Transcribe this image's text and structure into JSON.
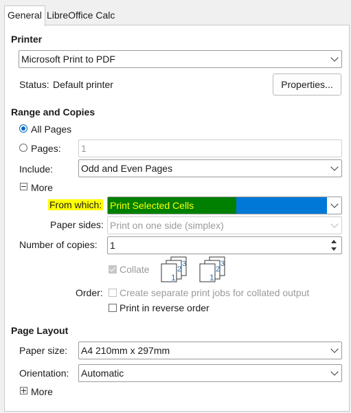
{
  "tabs": [
    {
      "label": "General",
      "active": true
    },
    {
      "label": "LibreOffice Calc",
      "active": false
    }
  ],
  "printer": {
    "heading": "Printer",
    "selected": "Microsoft Print to PDF",
    "status_label": "Status:",
    "status_value": "Default printer",
    "properties_button": "Properties..."
  },
  "range": {
    "heading": "Range and Copies",
    "all_pages": "All Pages",
    "pages_label": "Pages:",
    "pages_value": "1",
    "include_label": "Include:",
    "include_value": "Odd and Even Pages",
    "more_label": "More",
    "from_which_label": "From which:",
    "from_which_value": "Print Selected Cells",
    "paper_sides_label": "Paper sides:",
    "paper_sides_value": "Print on one side (simplex)",
    "copies_label": "Number of copies:",
    "copies_value": "1",
    "collate_label": "Collate",
    "order_label": "Order:",
    "separate_jobs_label": "Create separate print jobs for collated output",
    "reverse_order_label": "Print in reverse order"
  },
  "layout": {
    "heading": "Page Layout",
    "paper_size_label": "Paper size:",
    "paper_size_value": "A4 210mm x 297mm",
    "orientation_label": "Orientation:",
    "orientation_value": "Automatic",
    "more_label": "More"
  },
  "colors": {
    "highlight_yellow": "#ffff00",
    "selection_green": "#008000",
    "selection_blue": "#0078d7",
    "accent": "#0067c0"
  }
}
